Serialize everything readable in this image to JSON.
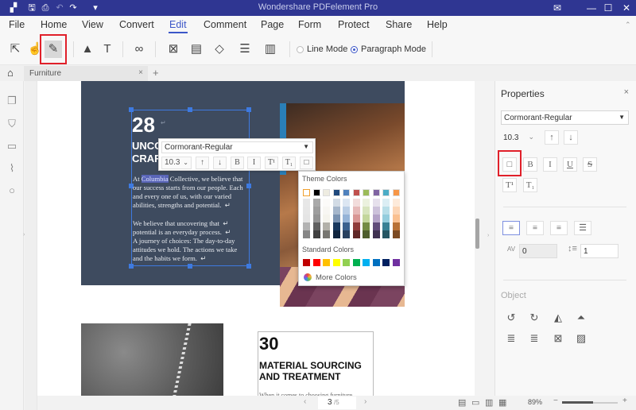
{
  "app": {
    "title": "Wondershare PDFelement Pro",
    "accent": "#3c57c8",
    "titlebar_color": "#2f3692"
  },
  "quick_access": [
    "logo-icon",
    "save-icon",
    "print-icon",
    "undo-icon",
    "redo-icon",
    "customize-icon"
  ],
  "window_controls": [
    "mail-icon",
    "minimize-icon",
    "maximize-icon",
    "close-icon"
  ],
  "menu": {
    "items": [
      "File",
      "Home",
      "View",
      "Convert",
      "Edit",
      "Comment",
      "Page",
      "Form",
      "Protect",
      "Share",
      "Help"
    ],
    "active": "Edit"
  },
  "toolbar": {
    "tools": [
      "select-icon",
      "hand-icon",
      "edit-text-icon",
      "add-image-icon",
      "add-text-icon",
      "link-icon",
      "crop-icon",
      "watermark-icon",
      "background-icon",
      "header-footer-icon",
      "bates-icon"
    ],
    "line_mode_label": "Line Mode",
    "paragraph_mode_label": "Paragraph Mode",
    "selected_mode": "Paragraph Mode"
  },
  "tabs": {
    "home_icon": "home-icon",
    "document_tab": "Furniture",
    "close": "×",
    "add": "+"
  },
  "document": {
    "page1": {
      "number": "28",
      "heading_line1": "UNCO",
      "heading_line2": "CRAF",
      "para1_pre": "At ",
      "para1_highlight": "Columbia",
      "para1_post": " Collective, we believe that\nour success starts from our people. Each\nand every one of us, with our varied\nabilities, strengths and potential.  ↵",
      "para2": "We believe that uncovering that  ↵\npotential is an everyday process.  ↵\nA journey of choices: The day-to-day\nattitudes we hold. The actions we take\nand the habits we form.  ↵",
      "return_mark": "↵"
    },
    "page2": {
      "number": "30",
      "heading": "MATERIAL SOURCING\nAND TREATMENT",
      "body_fragment": "When it comes to choosing furniture"
    }
  },
  "font_toolbar": {
    "font": "Cormorant-Regular",
    "size": "10.3",
    "buttons": [
      "↑",
      "↓",
      "B",
      "I",
      "T¹",
      "T₁",
      "□"
    ]
  },
  "color_picker": {
    "theme_label": "Theme Colors",
    "standard_label": "Standard Colors",
    "more_label": "More Colors",
    "theme_colors": [
      "#ffffff",
      "#000000",
      "#eeece1",
      "#1f497d",
      "#4f81bd",
      "#c0504d",
      "#9bbb59",
      "#8064a2",
      "#4bacc6",
      "#f79646"
    ],
    "standard_colors": [
      "#c00000",
      "#ff0000",
      "#ffc000",
      "#ffff00",
      "#92d050",
      "#00b050",
      "#00b0f0",
      "#0070c0",
      "#002060",
      "#7030a0"
    ]
  },
  "properties": {
    "title": "Properties",
    "close": "×",
    "font": "Cormorant-Regular",
    "size": "10.3",
    "style_buttons": [
      "□",
      "B",
      "I",
      "U",
      "S"
    ],
    "script_buttons": [
      "T¹",
      "T₁"
    ],
    "align_buttons": [
      "align-left-icon",
      "align-center-icon",
      "align-right-icon",
      "justify-icon"
    ],
    "char_spacing": "0",
    "line_spacing": "1",
    "object_label": "Object",
    "object_tools": [
      "rotate-left-icon",
      "rotate-right-icon",
      "flip-horizontal-icon",
      "flip-vertical-icon",
      "align-objects-icon",
      "distribute-icon",
      "crop-object-icon",
      "replace-image-icon"
    ]
  },
  "status": {
    "current_page": "3",
    "total_pages": "/5",
    "prev": "‹",
    "next": "›",
    "zoom": "89%",
    "zoom_fraction": 0.55,
    "minus": "−",
    "plus": "+"
  }
}
